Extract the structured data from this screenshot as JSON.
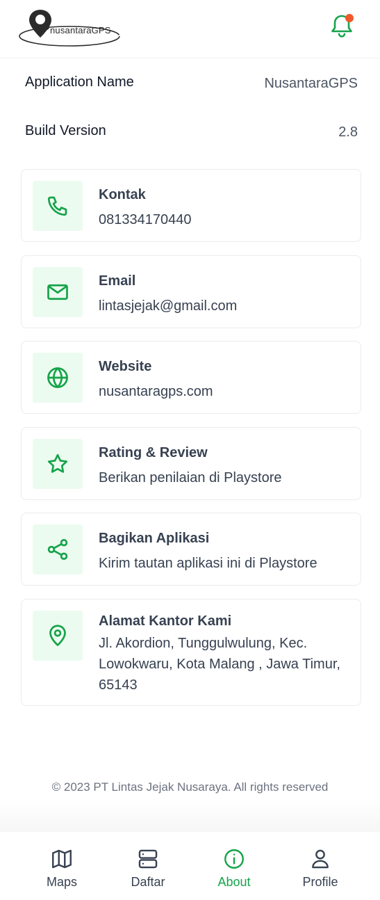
{
  "app": {
    "logo_text": "nusantaraGPS"
  },
  "info": [
    {
      "label": "Application Name",
      "value": "NusantaraGPS"
    },
    {
      "label": "Build Version",
      "value": "2.8"
    }
  ],
  "cards": [
    {
      "icon": "phone-icon",
      "title": "Kontak",
      "subtitle": "081334170440"
    },
    {
      "icon": "mail-icon",
      "title": "Email",
      "subtitle": "lintasjejak@gmail.com"
    },
    {
      "icon": "globe-icon",
      "title": "Website",
      "subtitle": "nusantaragps.com"
    },
    {
      "icon": "star-icon",
      "title": "Rating & Review",
      "subtitle": "Berikan penilaian di Playstore"
    },
    {
      "icon": "share-icon",
      "title": "Bagikan Aplikasi",
      "subtitle": "Kirim tautan aplikasi ini di Playstore"
    },
    {
      "icon": "map-pin-icon",
      "title": "Alamat Kantor Kami",
      "subtitle": "Jl. Akordion, Tunggulwulung, Kec. Lowokwaru, Kota Malang , Jawa Timur, 65143"
    }
  ],
  "footer": {
    "copyright": "© 2023 PT Lintas Jejak Nusaraya. All rights reserved"
  },
  "nav": [
    {
      "label": "Maps",
      "icon": "map-icon",
      "active": false
    },
    {
      "label": "Daftar",
      "icon": "server-icon",
      "active": false
    },
    {
      "label": "About",
      "icon": "info-icon",
      "active": true
    },
    {
      "label": "Profile",
      "icon": "user-icon",
      "active": false
    }
  ],
  "colors": {
    "accent": "#16a34a",
    "icon_bg": "#ecfbf0",
    "notification_dot": "#f1592a"
  }
}
